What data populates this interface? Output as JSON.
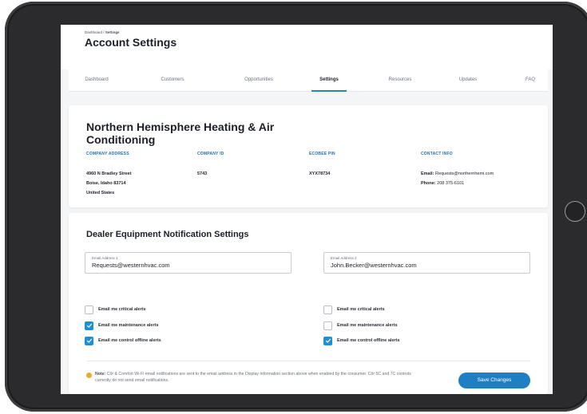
{
  "breadcrumb": {
    "parent": "Dashboard",
    "separator": "/",
    "current": "Settings"
  },
  "page_title": "Account Settings",
  "nav": {
    "items": [
      {
        "label": "Dashboard",
        "active": false
      },
      {
        "label": "Customers",
        "active": false
      },
      {
        "label": "Opportunities",
        "active": false
      },
      {
        "label": "Settings",
        "active": true
      },
      {
        "label": "Resources",
        "active": false
      },
      {
        "label": "Updates",
        "active": false
      },
      {
        "label": "FAQ",
        "active": false
      }
    ]
  },
  "company": {
    "name": "Northern Hemisphere Heating & Air Conditioning",
    "address_label": "COMPANY ADDRESS",
    "address_lines": [
      "4960 N Bradley Street",
      "Boise, Idaho 83714",
      "United States"
    ],
    "id_label": "COMPANY ID",
    "id_value": "5743",
    "pin_label": "ECOBEE PIN",
    "pin_value": "XYX78734",
    "contact_label": "CONTACT INFO",
    "email_label": "Email:",
    "email_value": "Requests@northernhemi.com",
    "phone_label": "Phone:",
    "phone_value": "208 375-6101"
  },
  "notifications": {
    "title": "Dealer Equipment Notification Settings",
    "email1": {
      "label": "Email Address 1",
      "value": "Requests@westernhvac.com",
      "critical": {
        "label": "Email me critical alerts",
        "checked": false
      },
      "maintenance": {
        "label": "Email me maintenance alerts",
        "checked": true
      },
      "offline": {
        "label": "Email me control offline alerts",
        "checked": true
      }
    },
    "email2": {
      "label": "Email Address 2",
      "value": "John.Becker@westernhvac.com",
      "critical": {
        "label": "Email me critical alerts",
        "checked": false
      },
      "maintenance": {
        "label": "Email me maintenance alerts",
        "checked": false
      },
      "offline": {
        "label": "Email me control offline alerts",
        "checked": true
      }
    },
    "note_label": "Note:",
    "note_text": "Côr & Comfort Wi-Fi email notifications are sent to the email address in the Display information section above when enabled by the consumer. Côr 5C and 7C controls currently do not send email notifications.",
    "save_label": "Save Changes"
  },
  "colors": {
    "accent": "#1f8ea3",
    "primary_button": "#1f7fc4",
    "checkbox_checked": "#1f8fd4",
    "info_label": "#1f6fa8",
    "note_icon": "#f0a830"
  }
}
